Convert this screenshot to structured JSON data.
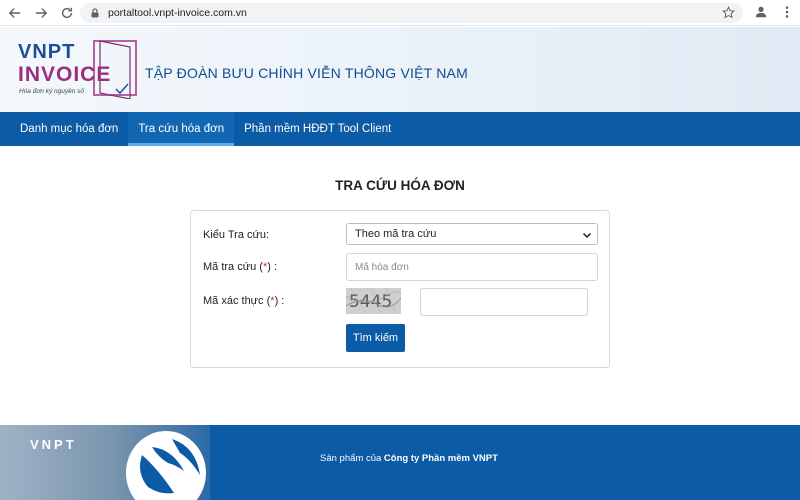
{
  "browser": {
    "url": "portaltool.vnpt-invoice.com.vn"
  },
  "header": {
    "logo_line1": "VNPT",
    "logo_line2": "INVOICE",
    "logo_tagline": "Hóa đơn ký nguyên số",
    "title": "TẬP  ĐOÀN BƯU CHÍNH VIỄN THÔNG VIỆT NAM"
  },
  "nav": {
    "items": [
      {
        "label": "Danh mục hóa đơn"
      },
      {
        "label": "Tra cứu hóa đơn"
      },
      {
        "label": "Phần mềm HĐĐT Tool Client"
      }
    ],
    "active_index": 1
  },
  "page": {
    "title": "TRA CỨU HÓA ĐƠN"
  },
  "form": {
    "lookup_type_label": "Kiểu Tra cứu:",
    "lookup_type_value": "Theo mã tra cứu",
    "lookup_code_label": "Mã tra cứu (",
    "lookup_code_label_end": ") :",
    "lookup_code_placeholder": "Mã hóa đơn",
    "verify_code_label": "Mã xác thực (",
    "verify_code_label_end": ") :",
    "required_mark": "*",
    "captcha_text": "5445",
    "search_button": "Tìm kiếm"
  },
  "footer": {
    "brand": "VNPT",
    "text_prefix": "Sản phẩm của ",
    "text_company": "Công ty Phần mềm VNPT"
  },
  "colors": {
    "primary": "#0b5ba6",
    "required": "#d9232d",
    "logo_purple": "#9b2f7d"
  }
}
